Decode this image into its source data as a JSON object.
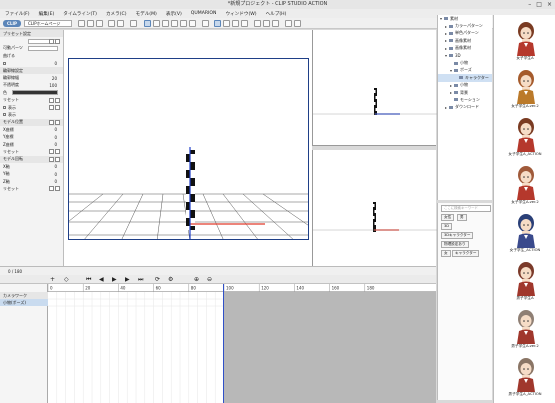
{
  "window": {
    "title": "*新規プロジェクト - CLIP STUDIO ACTION",
    "controls": [
      "–",
      "□",
      "×"
    ]
  },
  "menu": [
    "ファイル(F)",
    "編集(E)",
    "タイムライン(T)",
    "カメラ(C)",
    "モデル(M)",
    "表示(V)",
    "QUMARION",
    "ウィンドウ(W)",
    "ヘルプ(H)"
  ],
  "toolbar": {
    "badge": "CLIP",
    "clip_label": "CLIPホームページ"
  },
  "left_panel": {
    "rows": [
      {
        "label": "プリセット設定",
        "kind": "header"
      },
      {
        "label": "",
        "kind": "field"
      },
      {
        "label": "可動パーツ",
        "kind": "field"
      },
      {
        "label": "曲げる",
        "kind": "text"
      },
      {
        "label": "",
        "kind": "value",
        "value": "0"
      },
      {
        "label": "輪郭線設定",
        "kind": "header"
      },
      {
        "label": "輪郭線幅",
        "kind": "value",
        "value": "20"
      },
      {
        "label": "不透明度",
        "kind": "value",
        "value": "100"
      },
      {
        "label": "色",
        "kind": "darkbar"
      },
      {
        "label": "リセット",
        "kind": "pm"
      },
      {
        "label": "表示",
        "kind": "pm"
      },
      {
        "label": "表示",
        "kind": "text"
      },
      {
        "label": "モデル位置",
        "kind": "pm"
      },
      {
        "label": "X座標",
        "kind": "value",
        "value": "0"
      },
      {
        "label": "Y座標",
        "kind": "value",
        "value": "0"
      },
      {
        "label": "Z座標",
        "kind": "value",
        "value": "0"
      },
      {
        "label": "リセット",
        "kind": "pm"
      },
      {
        "label": "モデル回転",
        "kind": "pm"
      },
      {
        "label": "X軸",
        "kind": "value",
        "value": "0"
      },
      {
        "label": "Y軸",
        "kind": "value",
        "value": "0"
      },
      {
        "label": "Z軸",
        "kind": "value",
        "value": "0"
      },
      {
        "label": "リセット",
        "kind": "pm"
      }
    ]
  },
  "tree": [
    {
      "label": "素材",
      "level": 0,
      "expanded": true
    },
    {
      "label": "カラーパターン",
      "level": 1
    },
    {
      "label": "単色パターン",
      "level": 1
    },
    {
      "label": "画像素材",
      "level": 1
    },
    {
      "label": "画像素材",
      "level": 1
    },
    {
      "label": "3D",
      "level": 1,
      "expanded": true
    },
    {
      "label": "小物",
      "level": 2
    },
    {
      "label": "ポーズ",
      "level": 2,
      "expanded": true
    },
    {
      "label": "キャラクター",
      "level": 3,
      "selected": true
    },
    {
      "label": "小物",
      "level": 2
    },
    {
      "label": "背景",
      "level": 2
    },
    {
      "label": "モーション",
      "level": 2
    },
    {
      "label": "ダウンロード",
      "level": 1
    }
  ],
  "search": {
    "placeholder": "ここに検索キーワード",
    "tags": [
      "女性",
      "男",
      "3D",
      "3Dキャラクター",
      "物理設定あり",
      "女",
      "キャラクター"
    ]
  },
  "characters": [
    {
      "name": "女子学生A",
      "hair": "#7a3b22",
      "outfit": "#b5382c"
    },
    {
      "name": "女子学生A-ver.2",
      "hair": "#a55b2c",
      "outfit": "#bb7a2a"
    },
    {
      "name": "女子学生A_ACTION",
      "hair": "#7a3b22",
      "outfit": "#b5382c"
    },
    {
      "name": "女子学生A-ver.2",
      "hair": "#a05a3a",
      "outfit": "#b5382c"
    },
    {
      "name": "女子学生_ACTION",
      "hair": "#2a3f77",
      "outfit": "#3a4a8c"
    },
    {
      "name": "男子学生A",
      "hair": "#7b3a2a",
      "outfit": "#a0372c"
    },
    {
      "name": "男子学生A-ver.2",
      "hair": "#8f7f74",
      "outfit": "#a0372c"
    },
    {
      "name": "男子学生A_ACTION",
      "hair": "#8a7565",
      "outfit": "#a0372c"
    }
  ],
  "timeline": {
    "frame_display": "0 / 180",
    "ruler_labels": [
      "0",
      "20",
      "40",
      "60",
      "80",
      "100",
      "120",
      "140",
      "160",
      "180"
    ],
    "tracks": [
      "カメラワーク",
      "小物(ポーズ)"
    ]
  },
  "colors": {
    "accent": "#5c86b9",
    "axis_red": "#e03a2a",
    "axis_blue": "#1f3fc9",
    "cursor": "#3050c8"
  }
}
